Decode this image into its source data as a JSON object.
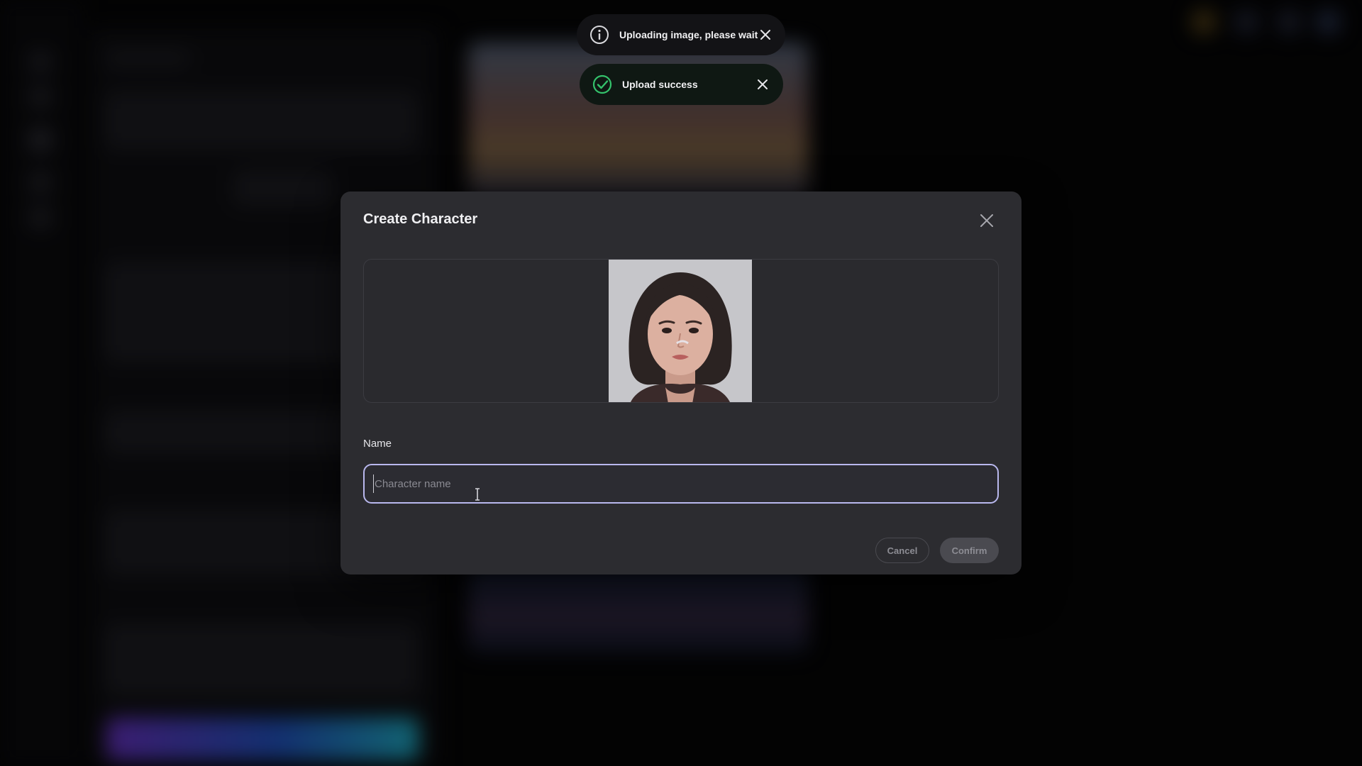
{
  "toasts": {
    "info": {
      "text": "Uploading image, please wait",
      "icon": "info-icon"
    },
    "success": {
      "text": "Upload success",
      "icon": "check-circle-icon",
      "color": "#34c26b"
    }
  },
  "modal": {
    "title": "Create Character",
    "name_label": "Name",
    "name_placeholder": "Character name",
    "name_value": "",
    "cancel_label": "Cancel",
    "confirm_label": "Confirm"
  },
  "colors": {
    "modal_bg": "#2c2c30",
    "input_focus_border": "#b9b8ee",
    "success_green": "#34c26b"
  }
}
